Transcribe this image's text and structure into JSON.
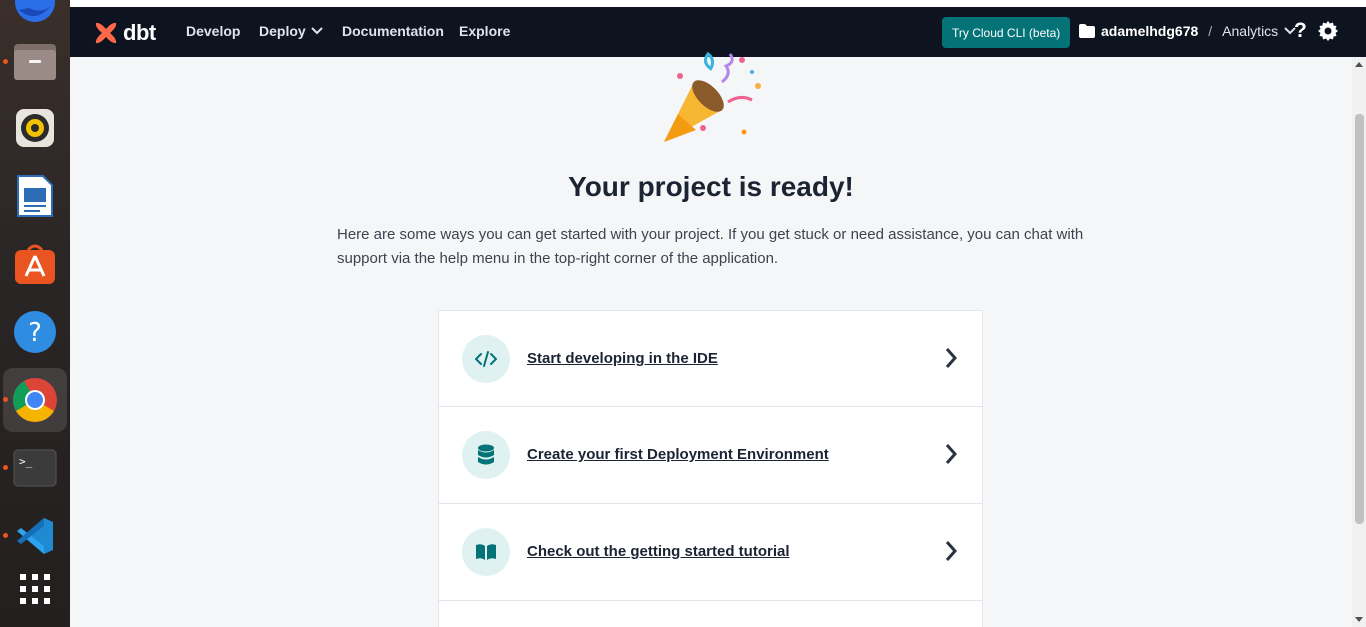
{
  "dock": {
    "apps": [
      "firefox-icon",
      "files-icon",
      "rhythmbox-icon",
      "writer-icon",
      "app-center-icon",
      "help-icon",
      "chrome-icon",
      "terminal-icon",
      "vscode-icon",
      "show-apps-icon"
    ]
  },
  "navbar": {
    "logo_text": "dbt",
    "links": [
      "Develop",
      "Deploy",
      "Documentation",
      "Explore"
    ],
    "try_button": "Try Cloud CLI (beta)",
    "account": "adamelhdg678",
    "separator": "/",
    "project": "Analytics",
    "help": "?"
  },
  "main": {
    "title": "Your project is ready!",
    "intro": "Here are some ways you can get started with your project. If you get stuck or need assistance, you can chat with support via the help menu in the top-right corner of the application.",
    "cards": [
      {
        "label": "Start developing in the IDE",
        "icon": "code-icon"
      },
      {
        "label": "Create your first Deployment Environment",
        "icon": "database-icon"
      },
      {
        "label": "Check out the getting started tutorial",
        "icon": "book-icon"
      }
    ]
  },
  "colors": {
    "navbar": "#0d1420",
    "accent_teal": "#047377",
    "brand_orange": "#ff694a"
  }
}
